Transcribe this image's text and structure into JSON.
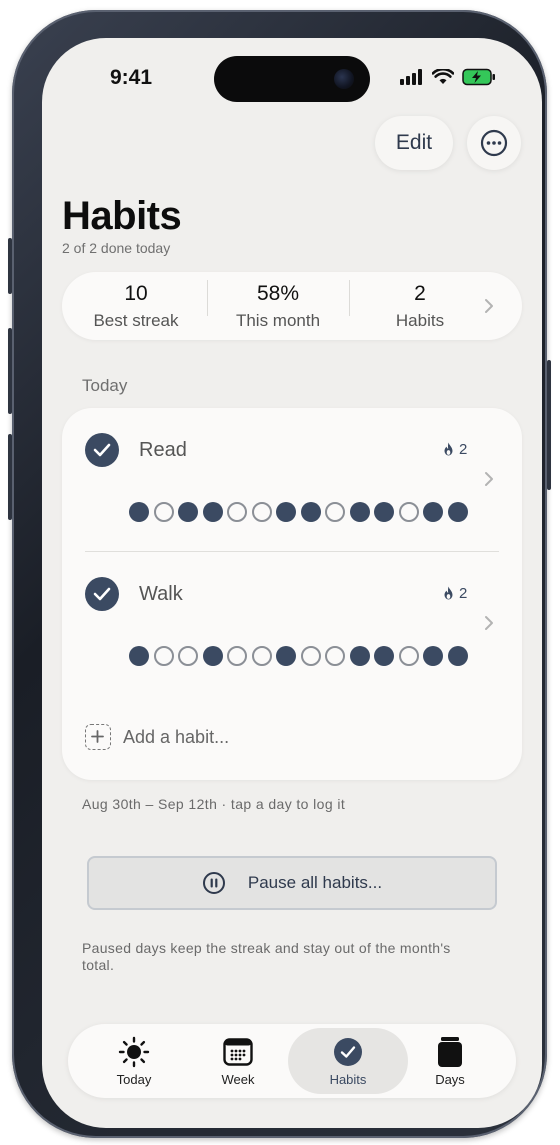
{
  "status_bar": {
    "time": "9:41"
  },
  "header": {
    "edit_label": "Edit",
    "more_icon": "ellipsis-circle-icon",
    "title": "Habits",
    "subtitle": "2 of 2 done today"
  },
  "stats": [
    {
      "value": "10",
      "label": "Best streak"
    },
    {
      "value": "58%",
      "label": "This month"
    },
    {
      "value": "2",
      "label": "Habits"
    }
  ],
  "today": {
    "section_label": "Today",
    "habits": [
      {
        "name": "Read",
        "done": true,
        "streak": "2",
        "days": [
          1,
          0,
          1,
          1,
          0,
          0,
          1,
          1,
          0,
          1,
          1,
          0,
          1,
          1
        ]
      },
      {
        "name": "Walk",
        "done": true,
        "streak": "2",
        "days": [
          1,
          0,
          0,
          1,
          0,
          0,
          1,
          0,
          0,
          1,
          1,
          0,
          1,
          1
        ]
      }
    ],
    "add_label": "Add a habit..."
  },
  "range_hint": "Aug 30th – Sep 12th · tap a day to log it",
  "pause": {
    "label": "Pause all habits...",
    "note": "Paused days keep the streak and stay out of the month's total."
  },
  "tabs": [
    {
      "label": "Today",
      "icon": "sun-icon",
      "active": false
    },
    {
      "label": "Week",
      "icon": "calendar-icon",
      "active": false
    },
    {
      "label": "Habits",
      "icon": "checkmark-circle-icon",
      "active": true
    },
    {
      "label": "Days",
      "icon": "jar-icon",
      "active": false
    }
  ],
  "colors": {
    "accent": "#3b4a62",
    "background": "#f0efed",
    "card": "#fbfaf9",
    "battery": "#34c759"
  }
}
